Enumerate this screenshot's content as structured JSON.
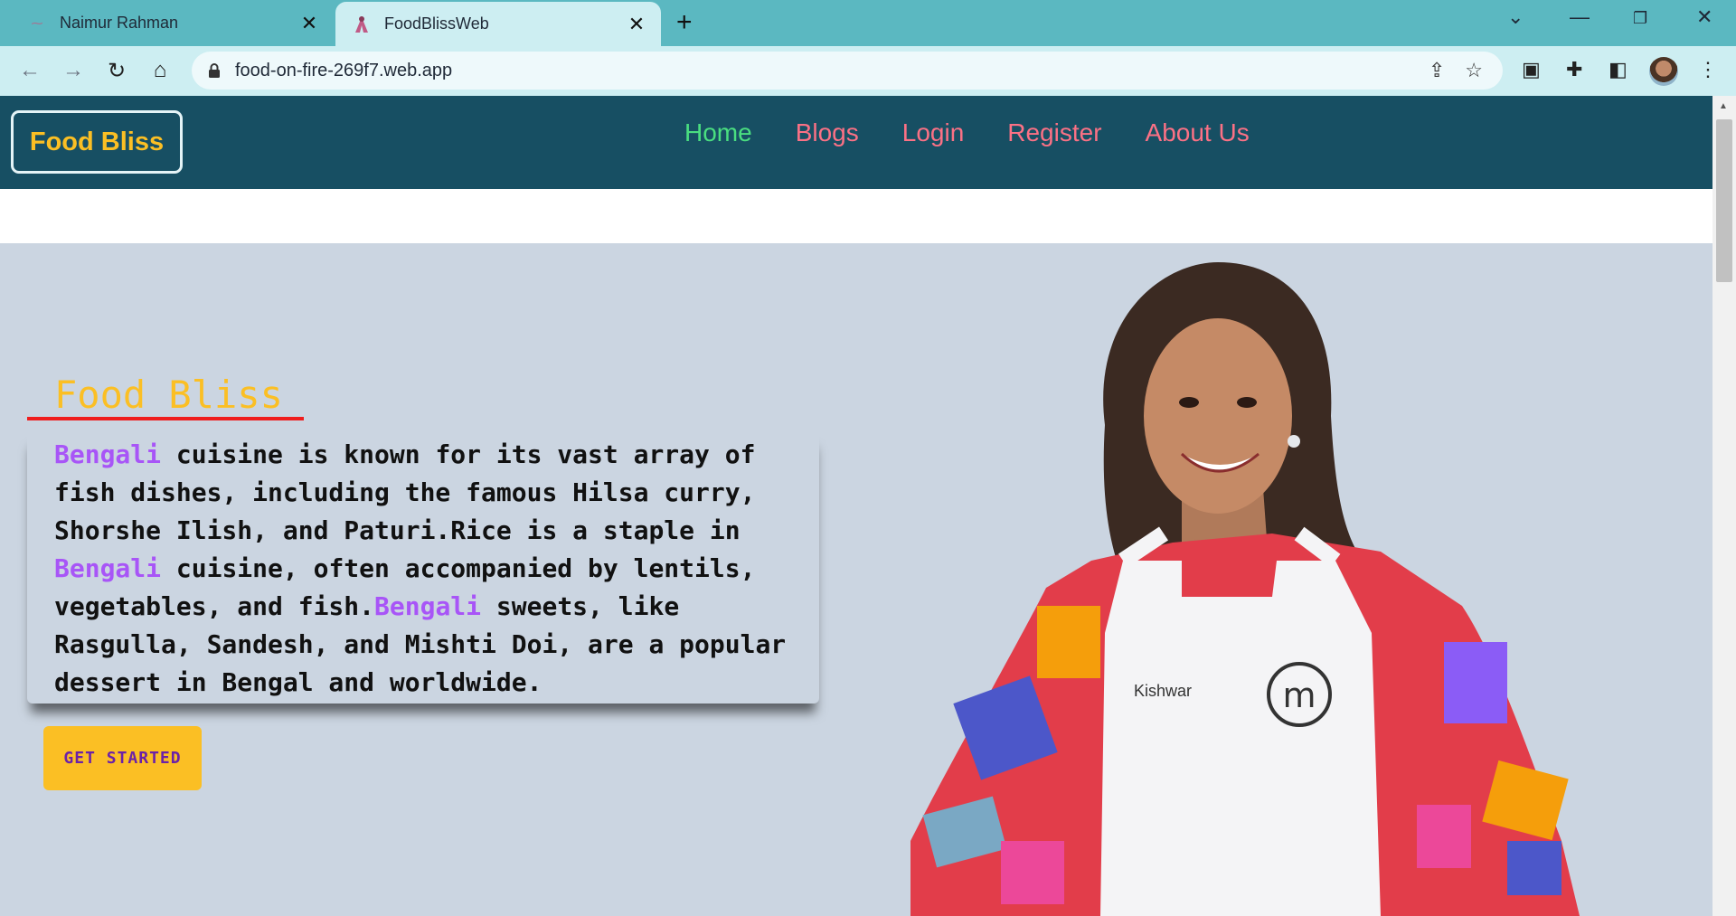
{
  "browser": {
    "tabs": [
      {
        "title": "Naimur Rahman",
        "active": false
      },
      {
        "title": "FoodBlissWeb",
        "active": true
      }
    ],
    "url": "food-on-fire-269f7.web.app"
  },
  "site": {
    "brand": "Food Bliss",
    "nav": [
      "Home",
      "Blogs",
      "Login",
      "Register",
      "About Us"
    ],
    "active_nav": "Home",
    "hero": {
      "title": "Food Bliss",
      "highlight_word": "Bengali",
      "segments": [
        " cuisine is known for its vast array of fish dishes, including the famous Hilsa curry, Shorshe Ilish, and Paturi.Rice is a staple in ",
        " cuisine, often accompanied by lentils, vegetables, and fish.",
        " sweets, like Rasgulla, Sandesh, and Mishti Doi, are a popular dessert in Bengal and worldwide."
      ],
      "cta": "GET STARTED",
      "image_label": "Kishwar"
    }
  },
  "colors": {
    "nav_bg": "#174f63",
    "accent_yellow": "#fbbf24",
    "link_pink": "#fb7185",
    "link_active": "#4ade80",
    "highlight_purple": "#a855f7",
    "underline_red": "#ef1d1d",
    "page_bg": "#cbd5e1"
  }
}
